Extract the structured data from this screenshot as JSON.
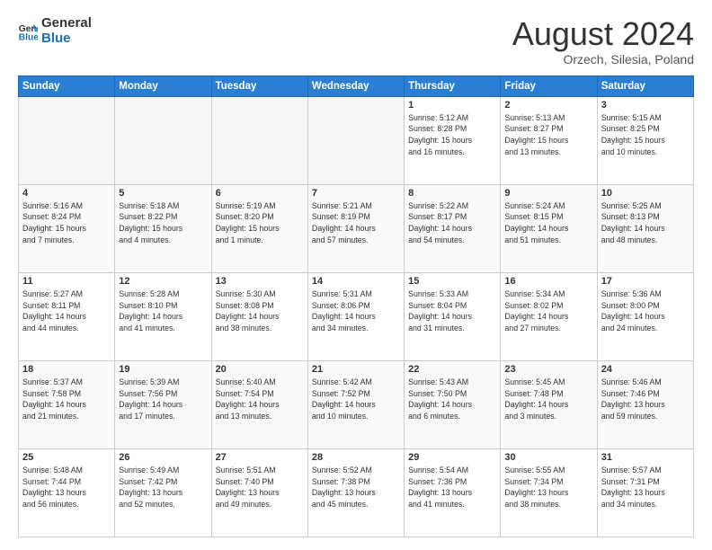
{
  "logo": {
    "general": "General",
    "blue": "Blue"
  },
  "header": {
    "month": "August 2024",
    "location": "Orzech, Silesia, Poland"
  },
  "weekdays": [
    "Sunday",
    "Monday",
    "Tuesday",
    "Wednesday",
    "Thursday",
    "Friday",
    "Saturday"
  ],
  "weeks": [
    [
      {
        "day": "",
        "info": ""
      },
      {
        "day": "",
        "info": ""
      },
      {
        "day": "",
        "info": ""
      },
      {
        "day": "",
        "info": ""
      },
      {
        "day": "1",
        "info": "Sunrise: 5:12 AM\nSunset: 8:28 PM\nDaylight: 15 hours\nand 16 minutes."
      },
      {
        "day": "2",
        "info": "Sunrise: 5:13 AM\nSunset: 8:27 PM\nDaylight: 15 hours\nand 13 minutes."
      },
      {
        "day": "3",
        "info": "Sunrise: 5:15 AM\nSunset: 8:25 PM\nDaylight: 15 hours\nand 10 minutes."
      }
    ],
    [
      {
        "day": "4",
        "info": "Sunrise: 5:16 AM\nSunset: 8:24 PM\nDaylight: 15 hours\nand 7 minutes."
      },
      {
        "day": "5",
        "info": "Sunrise: 5:18 AM\nSunset: 8:22 PM\nDaylight: 15 hours\nand 4 minutes."
      },
      {
        "day": "6",
        "info": "Sunrise: 5:19 AM\nSunset: 8:20 PM\nDaylight: 15 hours\nand 1 minute."
      },
      {
        "day": "7",
        "info": "Sunrise: 5:21 AM\nSunset: 8:19 PM\nDaylight: 14 hours\nand 57 minutes."
      },
      {
        "day": "8",
        "info": "Sunrise: 5:22 AM\nSunset: 8:17 PM\nDaylight: 14 hours\nand 54 minutes."
      },
      {
        "day": "9",
        "info": "Sunrise: 5:24 AM\nSunset: 8:15 PM\nDaylight: 14 hours\nand 51 minutes."
      },
      {
        "day": "10",
        "info": "Sunrise: 5:25 AM\nSunset: 8:13 PM\nDaylight: 14 hours\nand 48 minutes."
      }
    ],
    [
      {
        "day": "11",
        "info": "Sunrise: 5:27 AM\nSunset: 8:11 PM\nDaylight: 14 hours\nand 44 minutes."
      },
      {
        "day": "12",
        "info": "Sunrise: 5:28 AM\nSunset: 8:10 PM\nDaylight: 14 hours\nand 41 minutes."
      },
      {
        "day": "13",
        "info": "Sunrise: 5:30 AM\nSunset: 8:08 PM\nDaylight: 14 hours\nand 38 minutes."
      },
      {
        "day": "14",
        "info": "Sunrise: 5:31 AM\nSunset: 8:06 PM\nDaylight: 14 hours\nand 34 minutes."
      },
      {
        "day": "15",
        "info": "Sunrise: 5:33 AM\nSunset: 8:04 PM\nDaylight: 14 hours\nand 31 minutes."
      },
      {
        "day": "16",
        "info": "Sunrise: 5:34 AM\nSunset: 8:02 PM\nDaylight: 14 hours\nand 27 minutes."
      },
      {
        "day": "17",
        "info": "Sunrise: 5:36 AM\nSunset: 8:00 PM\nDaylight: 14 hours\nand 24 minutes."
      }
    ],
    [
      {
        "day": "18",
        "info": "Sunrise: 5:37 AM\nSunset: 7:58 PM\nDaylight: 14 hours\nand 21 minutes."
      },
      {
        "day": "19",
        "info": "Sunrise: 5:39 AM\nSunset: 7:56 PM\nDaylight: 14 hours\nand 17 minutes."
      },
      {
        "day": "20",
        "info": "Sunrise: 5:40 AM\nSunset: 7:54 PM\nDaylight: 14 hours\nand 13 minutes."
      },
      {
        "day": "21",
        "info": "Sunrise: 5:42 AM\nSunset: 7:52 PM\nDaylight: 14 hours\nand 10 minutes."
      },
      {
        "day": "22",
        "info": "Sunrise: 5:43 AM\nSunset: 7:50 PM\nDaylight: 14 hours\nand 6 minutes."
      },
      {
        "day": "23",
        "info": "Sunrise: 5:45 AM\nSunset: 7:48 PM\nDaylight: 14 hours\nand 3 minutes."
      },
      {
        "day": "24",
        "info": "Sunrise: 5:46 AM\nSunset: 7:46 PM\nDaylight: 13 hours\nand 59 minutes."
      }
    ],
    [
      {
        "day": "25",
        "info": "Sunrise: 5:48 AM\nSunset: 7:44 PM\nDaylight: 13 hours\nand 56 minutes."
      },
      {
        "day": "26",
        "info": "Sunrise: 5:49 AM\nSunset: 7:42 PM\nDaylight: 13 hours\nand 52 minutes."
      },
      {
        "day": "27",
        "info": "Sunrise: 5:51 AM\nSunset: 7:40 PM\nDaylight: 13 hours\nand 49 minutes."
      },
      {
        "day": "28",
        "info": "Sunrise: 5:52 AM\nSunset: 7:38 PM\nDaylight: 13 hours\nand 45 minutes."
      },
      {
        "day": "29",
        "info": "Sunrise: 5:54 AM\nSunset: 7:36 PM\nDaylight: 13 hours\nand 41 minutes."
      },
      {
        "day": "30",
        "info": "Sunrise: 5:55 AM\nSunset: 7:34 PM\nDaylight: 13 hours\nand 38 minutes."
      },
      {
        "day": "31",
        "info": "Sunrise: 5:57 AM\nSunset: 7:31 PM\nDaylight: 13 hours\nand 34 minutes."
      }
    ]
  ]
}
